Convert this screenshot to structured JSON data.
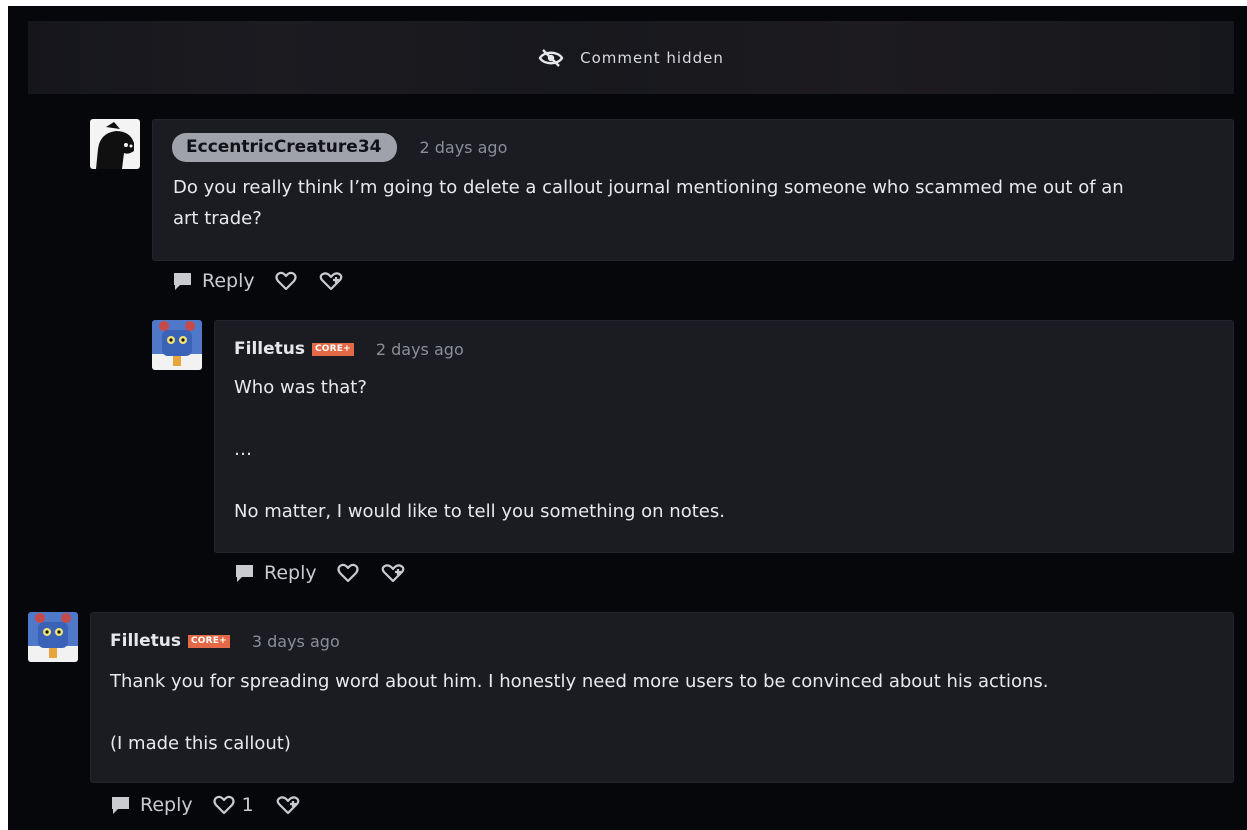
{
  "hidden_comment": {
    "label": "Comment hidden",
    "icon": "eye-slash-icon"
  },
  "comments": [
    {
      "username": "EccentricCreature34",
      "time": "2 days ago",
      "body": "Do you really think I’m going to delete a callout journal mentioning someone who scammed me out of an\nart trade?",
      "reply_label": "Reply"
    },
    {
      "username": "Filletus",
      "badge": "CORE+",
      "time": "2 days ago",
      "body": "Who was that?\n\n…\n\nNo matter, I would like to tell you something on notes.",
      "reply_label": "Reply"
    },
    {
      "username": "Filletus",
      "badge": "CORE+",
      "time": "3 days ago",
      "body": "Thank you for spreading word about him. I honestly need more users to be convinced about his actions.\n\n(I made this callout)",
      "reply_label": "Reply",
      "likes": "1"
    }
  ],
  "colors": {
    "background": "#06070b",
    "card": "#1a1c22",
    "badge": "#e46a47",
    "pill": "#9fa1ab"
  }
}
